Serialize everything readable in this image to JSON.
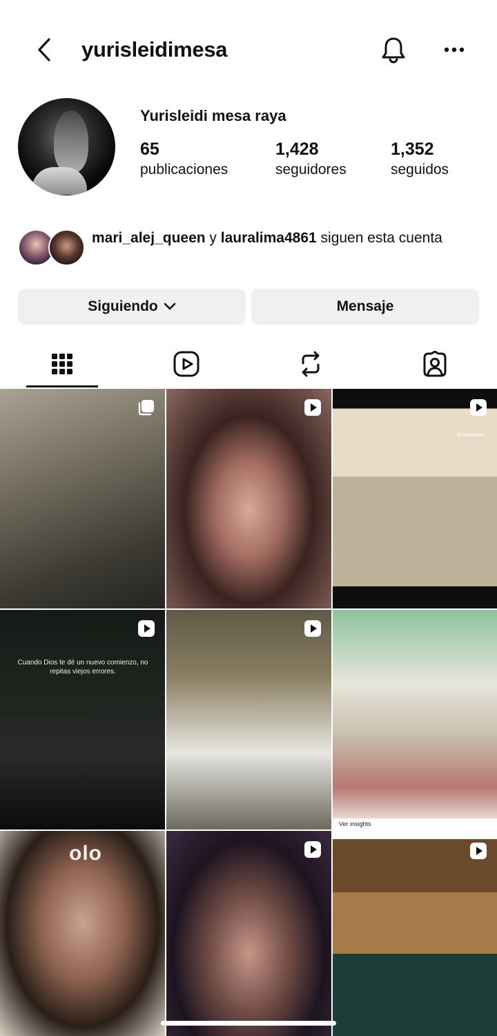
{
  "header": {
    "username": "yurisleidimesa",
    "back_icon": "chevron-left-icon",
    "bell_icon": "bell-icon",
    "more_icon": "more-horizontal-icon"
  },
  "profile": {
    "full_name": "Yurisleidi mesa raya",
    "stats": {
      "posts": {
        "value": "65",
        "label": "publicaciones"
      },
      "followers": {
        "value": "1,428",
        "label": "seguidores"
      },
      "following": {
        "value": "1,352",
        "label": "seguidos"
      }
    }
  },
  "mutuals": {
    "user1": "mari_alej_queen",
    "connector": " y ",
    "user2": "lauralima4861",
    "suffix": " siguen esta cuenta"
  },
  "actions": {
    "following_label": "Siguiendo",
    "message_label": "Mensaje"
  },
  "tabs": [
    {
      "name": "grid",
      "icon": "grid-icon",
      "active": true
    },
    {
      "name": "reels",
      "icon": "reels-icon",
      "active": false
    },
    {
      "name": "reposts",
      "icon": "repost-icon",
      "active": false
    },
    {
      "name": "tagged",
      "icon": "tagged-person-icon",
      "active": false
    }
  ],
  "grid": {
    "overlay_text": "Cuando Dios te dé un nuevo comienzo, no repitas viejos errores.",
    "watermark": "@ARIAMHG",
    "cap_logo": "olo",
    "insights_label": "Ver insights",
    "posts": [
      {
        "type": "carousel"
      },
      {
        "type": "reel"
      },
      {
        "type": "reel"
      },
      {
        "type": "reel"
      },
      {
        "type": "reel"
      },
      {
        "type": "photo"
      },
      {
        "type": "photo"
      },
      {
        "type": "reel"
      },
      {
        "type": "reel"
      }
    ]
  },
  "colors": {
    "button_bg": "#eef0f2",
    "text": "#111111",
    "background": "#ffffff"
  }
}
